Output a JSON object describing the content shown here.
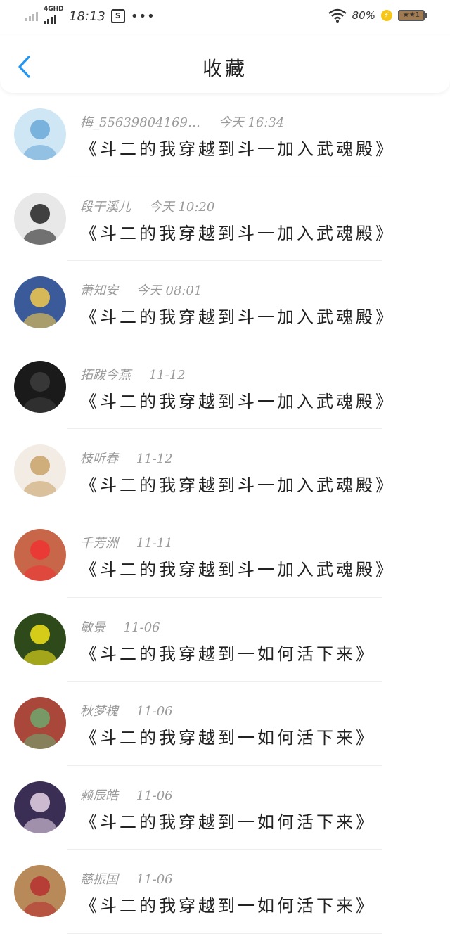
{
  "status_bar": {
    "network_type": "4GHD",
    "time": "18:13",
    "app_icon_glyph": "S",
    "more_dots": "•••",
    "battery_percent": "80%",
    "battery_label": "★★1",
    "charge_glyph": "⚡",
    "icons": [
      "signal-weak-icon",
      "signal-strong-icon",
      "notification-app-icon",
      "more-dots-icon",
      "wifi-icon",
      "charging-icon",
      "battery-icon"
    ]
  },
  "header": {
    "title": "收藏",
    "back_icon": "chevron-left-icon",
    "accent_color": "#2196f3"
  },
  "items": [
    {
      "user": "梅_55639804169…",
      "time": "今天 16:34",
      "title": "《斗二的我穿越到斗一加入武魂殿》",
      "avatar_color": "#cfe6f5",
      "avatar_accent": "#6aa9d8"
    },
    {
      "user": "段干溪儿",
      "time": "今天 10:20",
      "title": "《斗二的我穿越到斗一加入武魂殿》",
      "avatar_color": "#e8e8e8",
      "avatar_accent": "#222222"
    },
    {
      "user": "萧知安",
      "time": "今天 08:01",
      "title": "《斗二的我穿越到斗一加入武魂殿》",
      "avatar_color": "#3a5a9a",
      "avatar_accent": "#f2c94c"
    },
    {
      "user": "拓跋今燕",
      "time": "11-12",
      "title": "《斗二的我穿越到斗一加入武魂殿》",
      "avatar_color": "#1a1a1a",
      "avatar_accent": "#3d3d3d"
    },
    {
      "user": "枝听春",
      "time": "11-12",
      "title": "《斗二的我穿越到斗一加入武魂殿》",
      "avatar_color": "#f2ece4",
      "avatar_accent": "#c9a36a"
    },
    {
      "user": "千芳洲",
      "time": "11-11",
      "title": "《斗二的我穿越到斗一加入武魂殿》",
      "avatar_color": "#c8664a",
      "avatar_accent": "#e33"
    },
    {
      "user": "敏景",
      "time": "11-06",
      "title": "《斗二的我穿越到一如何活下来》",
      "avatar_color": "#2e4a1a",
      "avatar_accent": "#f2e21a"
    },
    {
      "user": "秋梦槐",
      "time": "11-06",
      "title": "《斗二的我穿越到一如何活下来》",
      "avatar_color": "#a8473a",
      "avatar_accent": "#6fa86f"
    },
    {
      "user": "赖辰皓",
      "time": "11-06",
      "title": "《斗二的我穿越到一如何活下来》",
      "avatar_color": "#3a2e55",
      "avatar_accent": "#e6d2e6"
    },
    {
      "user": "慈振国",
      "time": "11-06",
      "title": "《斗二的我穿越到一如何活下来》",
      "avatar_color": "#b88a5a",
      "avatar_accent": "#b53030"
    }
  ]
}
